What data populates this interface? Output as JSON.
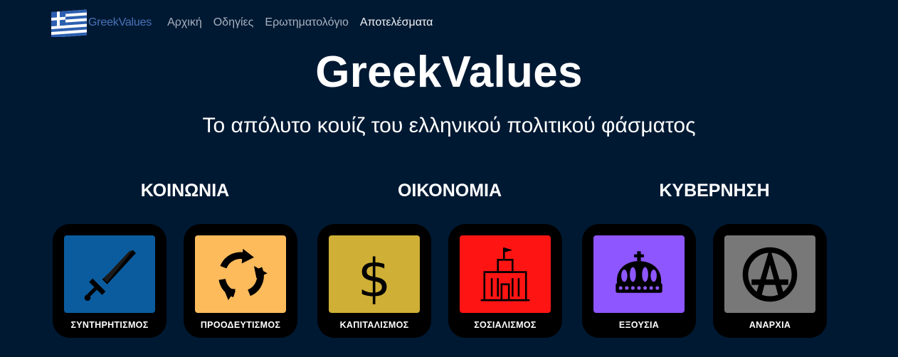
{
  "nav": {
    "brand": "GreekValues",
    "links": [
      "Αρχική",
      "Οδηγίες",
      "Ερωτηματολόγιο",
      "Αποτελέσματα"
    ]
  },
  "hero": {
    "title": "GreekValues",
    "subtitle": "Το απόλυτο κουίζ του ελληνικού πολιτικού φάσματος"
  },
  "categories": [
    {
      "heading": "ΚΟΙΝΩΝΙΑ",
      "cards": [
        {
          "label": "ΣΥΝΤΗΡΗΤΙΣΜΟΣ",
          "icon": "sword-icon",
          "color": "#0b5c9e"
        },
        {
          "label": "ΠΡΟΟΔΕΥΤΙΣΜΟΣ",
          "icon": "recycle-arrows-icon",
          "color": "#fdbb5c"
        }
      ]
    },
    {
      "heading": "ΟΙΚΟΝΟΜΙΑ",
      "cards": [
        {
          "label": "ΚΑΠΙΤΑΛΙΣΜΟΣ",
          "icon": "dollar-icon",
          "color": "#cfaf36"
        },
        {
          "label": "ΣΟΣΙΑΛΙΣΜΟΣ",
          "icon": "building-flag-icon",
          "color": "#ff1414"
        }
      ]
    },
    {
      "heading": "ΚΥΒΕΡΝΗΣΗ",
      "cards": [
        {
          "label": "ΕΞΟΥΣΙΑ",
          "icon": "crown-icon",
          "color": "#8e56ff"
        },
        {
          "label": "ΑΝΑΡΧΙΑ",
          "icon": "anarchy-icon",
          "color": "#787878"
        }
      ]
    }
  ]
}
